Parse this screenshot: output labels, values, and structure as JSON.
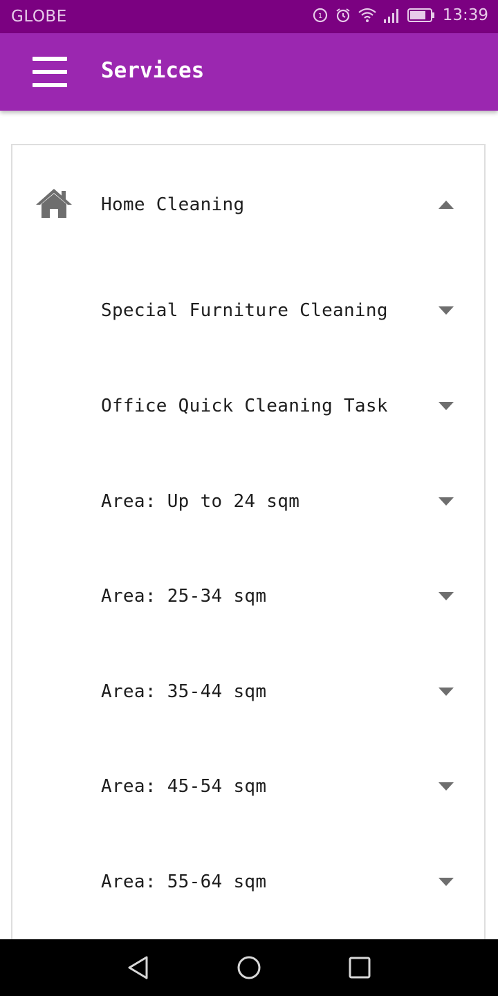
{
  "status_bar": {
    "carrier": "GLOBE",
    "time": "13:39",
    "icons": [
      "data-saver-icon",
      "alarm-icon",
      "wifi-icon",
      "signal-icon",
      "battery-icon"
    ]
  },
  "app_bar": {
    "title": "Services",
    "menu_icon": "hamburger-menu-icon"
  },
  "services": {
    "category": {
      "label": "Home Cleaning",
      "icon": "home-icon",
      "expanded": true
    },
    "items": [
      {
        "label": "Special Furniture Cleaning",
        "expanded": false
      },
      {
        "label": "Office Quick Cleaning Task",
        "expanded": false
      },
      {
        "label": "Area: Up to 24 sqm",
        "expanded": false
      },
      {
        "label": "Area: 25-34 sqm",
        "expanded": false
      },
      {
        "label": "Area: 35-44 sqm",
        "expanded": false
      },
      {
        "label": "Area: 45-54 sqm",
        "expanded": false
      },
      {
        "label": "Area: 55-64 sqm",
        "expanded": false
      }
    ]
  },
  "nav_bar": {
    "icons": [
      "back-icon",
      "home-circle-icon",
      "recents-icon"
    ]
  },
  "colors": {
    "status_bar": "#7b0181",
    "app_bar": "#9b27b0",
    "icon_gray": "#6e6e6e"
  }
}
